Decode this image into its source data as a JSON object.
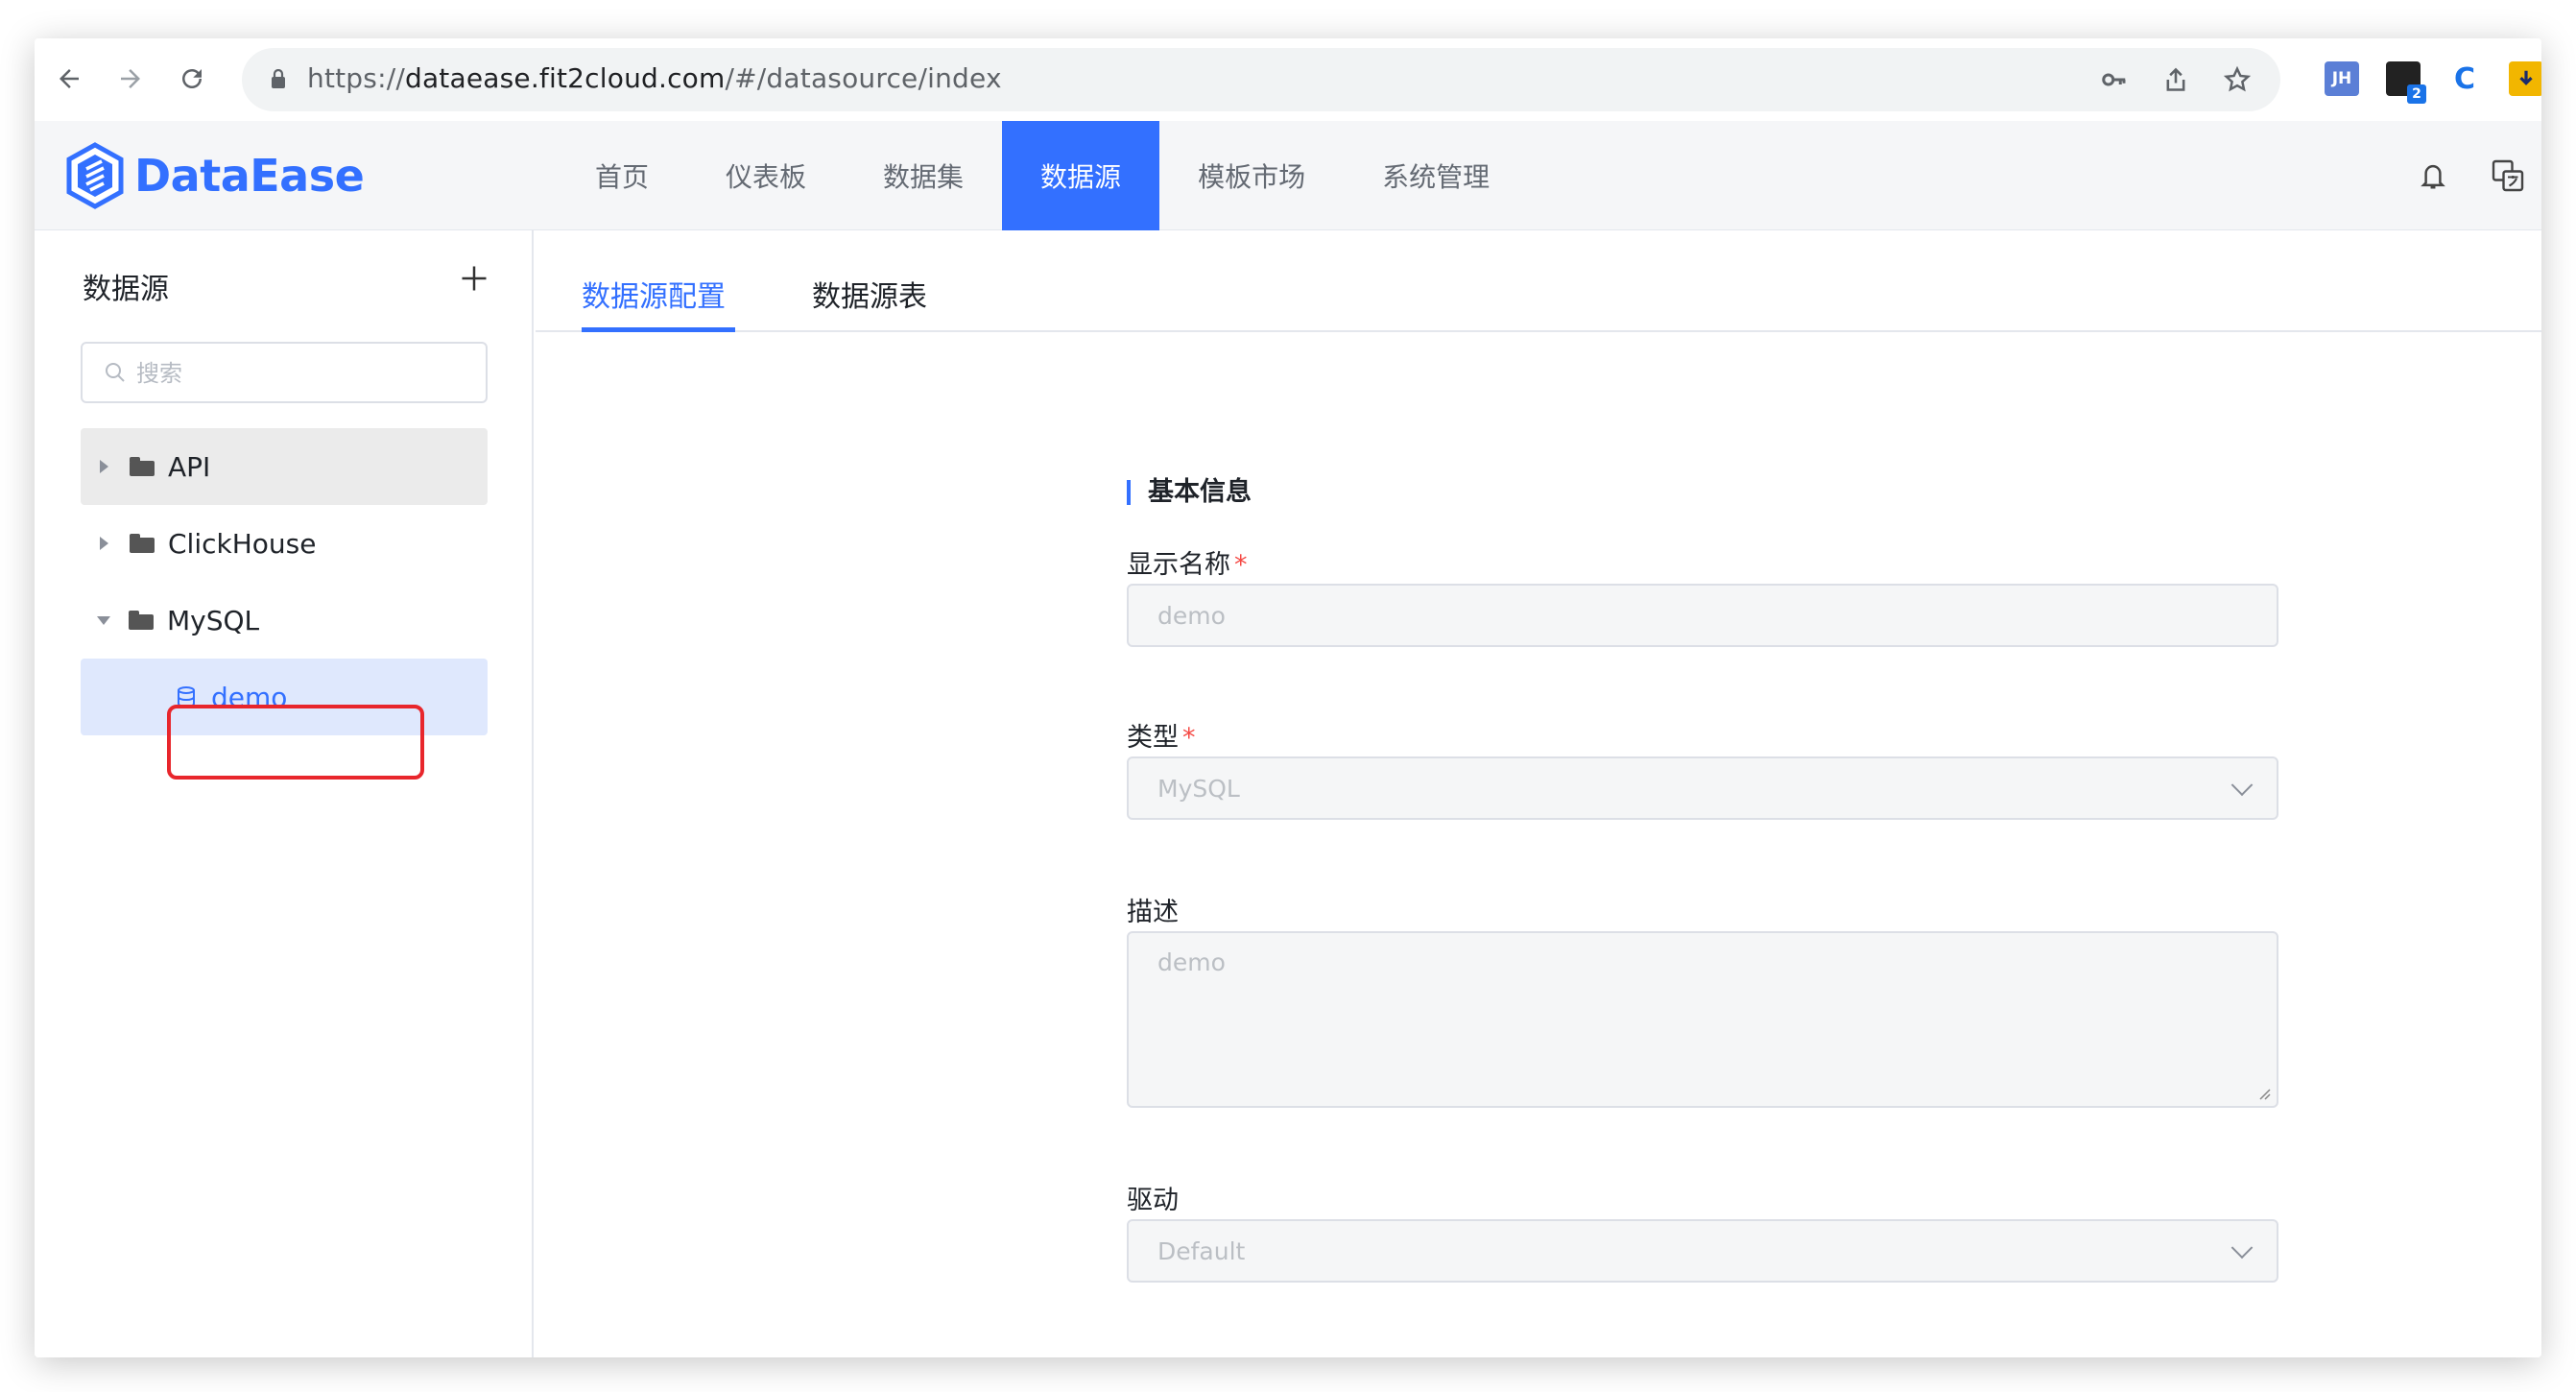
{
  "browser": {
    "url_scheme": "https://",
    "url_host": "dataease.fit2cloud.com",
    "url_path": "/#/datasource/index",
    "extensions": [
      {
        "name": "jh-extension",
        "label": "JH",
        "color": "#5b7fd6"
      },
      {
        "name": "badge-extension",
        "label": "2",
        "color": "#1a73e8"
      },
      {
        "name": "c-extension",
        "label": "C",
        "color": "#1a73e8"
      },
      {
        "name": "download-extension",
        "label": "",
        "color": "#f2b600"
      }
    ]
  },
  "app": {
    "brand": "DataEase",
    "brand_color": "#3370ff",
    "nav": [
      {
        "label": "首页",
        "active": false
      },
      {
        "label": "仪表板",
        "active": false
      },
      {
        "label": "数据集",
        "active": false
      },
      {
        "label": "数据源",
        "active": true
      },
      {
        "label": "模板市场",
        "active": false
      },
      {
        "label": "系统管理",
        "active": false
      }
    ]
  },
  "sidebar": {
    "title": "数据源",
    "search_placeholder": "搜索",
    "tree": [
      {
        "label": "API",
        "expanded": false
      },
      {
        "label": "ClickHouse",
        "expanded": false
      },
      {
        "label": "MySQL",
        "expanded": true
      },
      {
        "label": "demo",
        "selected": true
      }
    ]
  },
  "main": {
    "tabs": [
      {
        "label": "数据源配置",
        "active": true
      },
      {
        "label": "数据源表",
        "active": false
      }
    ],
    "form": {
      "section_title": "基本信息",
      "name_label": "显示名称",
      "name_value": "demo",
      "type_label": "类型",
      "type_value": "MySQL",
      "desc_label": "描述",
      "desc_value": "demo",
      "driver_label": "驱动",
      "driver_value": "Default",
      "required_mark": "*"
    }
  }
}
